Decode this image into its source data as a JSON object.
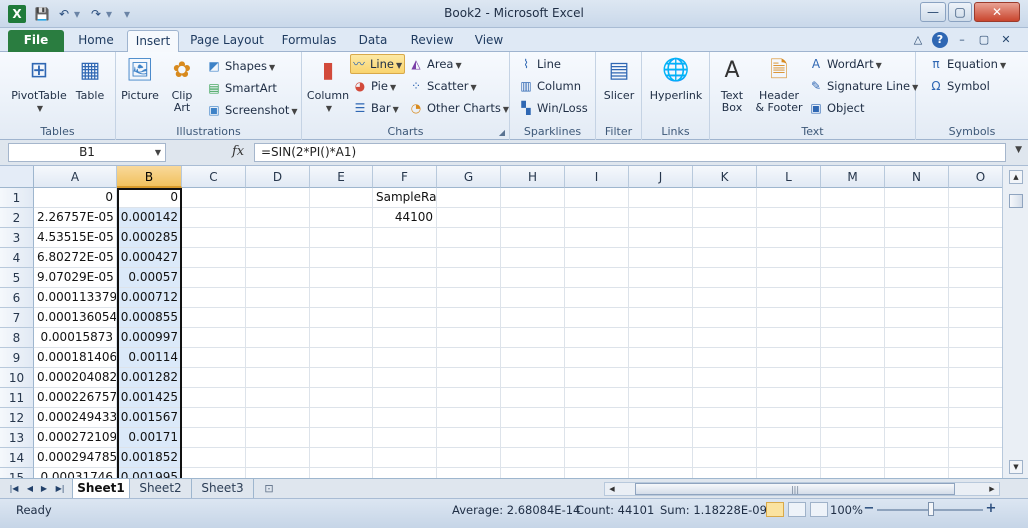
{
  "window": {
    "title": "Book2 - Microsoft Excel",
    "app_initial": "X",
    "buttons": {
      "minimize": "—",
      "maximize": "▢",
      "close": "✕"
    }
  },
  "quick_access": {
    "save": "💾",
    "undo": "↶",
    "redo": "↷",
    "more": "▾"
  },
  "ribbon_tabs": [
    "File",
    "Home",
    "Insert",
    "Page Layout",
    "Formulas",
    "Data",
    "Review",
    "View"
  ],
  "ribbon_right": {
    "minimize_ribbon": "△",
    "help": "?",
    "min": "–",
    "restore": "▢",
    "close": "✕"
  },
  "ribbon": {
    "tables": {
      "label": "Tables",
      "pivot": "PivotTable",
      "table": "Table"
    },
    "illustrations": {
      "label": "Illustrations",
      "picture": "Picture",
      "clipart_1": "Clip",
      "clipart_2": "Art",
      "shapes": "Shapes",
      "smartart": "SmartArt",
      "screenshot": "Screenshot"
    },
    "charts": {
      "label": "Charts",
      "column": "Column",
      "line": "Line",
      "pie": "Pie",
      "bar": "Bar",
      "area": "Area",
      "scatter": "Scatter",
      "other": "Other Charts"
    },
    "sparklines": {
      "label": "Sparklines",
      "line": "Line",
      "column": "Column",
      "winloss": "Win/Loss"
    },
    "filter": {
      "label": "Filter",
      "slicer": "Slicer"
    },
    "links": {
      "label": "Links",
      "hyperlink": "Hyperlink"
    },
    "text": {
      "label": "Text",
      "textbox_1": "Text",
      "textbox_2": "Box",
      "header_1": "Header",
      "header_2": "& Footer",
      "wordart": "WordArt",
      "signature": "Signature Line",
      "object": "Object"
    },
    "symbols": {
      "label": "Symbols",
      "equation": "Equation",
      "symbol": "Symbol"
    }
  },
  "formula_bar": {
    "name_box": "B1",
    "fx": "fx",
    "formula": "=SIN(2*PI()*A1)"
  },
  "columns": [
    "A",
    "B",
    "C",
    "D",
    "E",
    "F",
    "G",
    "H",
    "I",
    "J",
    "K",
    "L",
    "M",
    "N",
    "O"
  ],
  "rows": [
    {
      "num": "1",
      "a": "0",
      "b": "0"
    },
    {
      "num": "2",
      "a": "2.26757E-05",
      "b": "0.000142"
    },
    {
      "num": "3",
      "a": "4.53515E-05",
      "b": "0.000285"
    },
    {
      "num": "4",
      "a": "6.80272E-05",
      "b": "0.000427"
    },
    {
      "num": "5",
      "a": "9.07029E-05",
      "b": "0.00057"
    },
    {
      "num": "6",
      "a": "0.000113379",
      "b": "0.000712"
    },
    {
      "num": "7",
      "a": "0.000136054",
      "b": "0.000855"
    },
    {
      "num": "8",
      "a": "0.00015873",
      "b": "0.000997"
    },
    {
      "num": "9",
      "a": "0.000181406",
      "b": "0.00114"
    },
    {
      "num": "10",
      "a": "0.000204082",
      "b": "0.001282"
    },
    {
      "num": "11",
      "a": "0.000226757",
      "b": "0.001425"
    },
    {
      "num": "12",
      "a": "0.000249433",
      "b": "0.001567"
    },
    {
      "num": "13",
      "a": "0.000272109",
      "b": "0.00171"
    },
    {
      "num": "14",
      "a": "0.000294785",
      "b": "0.001852"
    },
    {
      "num": "15",
      "a": "0.00031746",
      "b": "0.001995"
    }
  ],
  "extra_cells": {
    "f1": "SampleRate",
    "f2": "44100"
  },
  "sheets": [
    "Sheet1",
    "Sheet2",
    "Sheet3"
  ],
  "status": {
    "ready": "Ready",
    "average": "Average: 2.68084E-14",
    "count": "Count: 44101",
    "sum": "Sum: 1.18228E-09",
    "zoom": "100%"
  }
}
